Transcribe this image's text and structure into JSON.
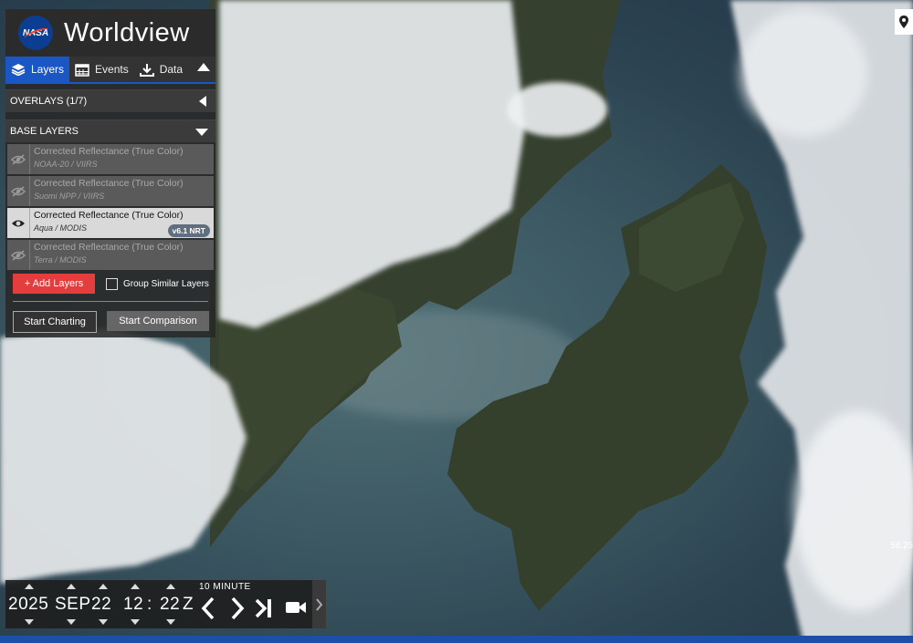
{
  "app": {
    "brand": "NASA",
    "title": "Worldview"
  },
  "tabs": [
    {
      "label": "Layers",
      "active": true
    },
    {
      "label": "Events",
      "active": false
    },
    {
      "label": "Data",
      "active": false
    }
  ],
  "overlays": {
    "header": "OVERLAYS (1/7)"
  },
  "base_layers": {
    "header": "BASE LAYERS",
    "items": [
      {
        "name": "Corrected Reflectance (True Color)",
        "source": "NOAA-20 / VIIRS",
        "visible": false
      },
      {
        "name": "Corrected Reflectance (True Color)",
        "source": "Suomi NPP / VIIRS",
        "visible": false
      },
      {
        "name": "Corrected Reflectance (True Color)",
        "source": "Aqua / MODIS",
        "visible": true,
        "badge": "v6.1 NRT"
      },
      {
        "name": "Corrected Reflectance (True Color)",
        "source": "Terra / MODIS",
        "visible": false
      }
    ]
  },
  "actions": {
    "add_layers": "+ Add Layers",
    "group_similar": "Group Similar Layers",
    "start_charting": "Start Charting",
    "start_comparison": "Start Comparison"
  },
  "timeline": {
    "year": "2025",
    "month": "SEP",
    "day": "22",
    "hour": "12",
    "separator": ":",
    "minute": "22",
    "zone": "Z",
    "interval": "10 MINUTE"
  },
  "map": {
    "coord_fragment": "58.25"
  },
  "colors": {
    "accent": "#1a56c4",
    "add_button": "#e33d3d"
  }
}
